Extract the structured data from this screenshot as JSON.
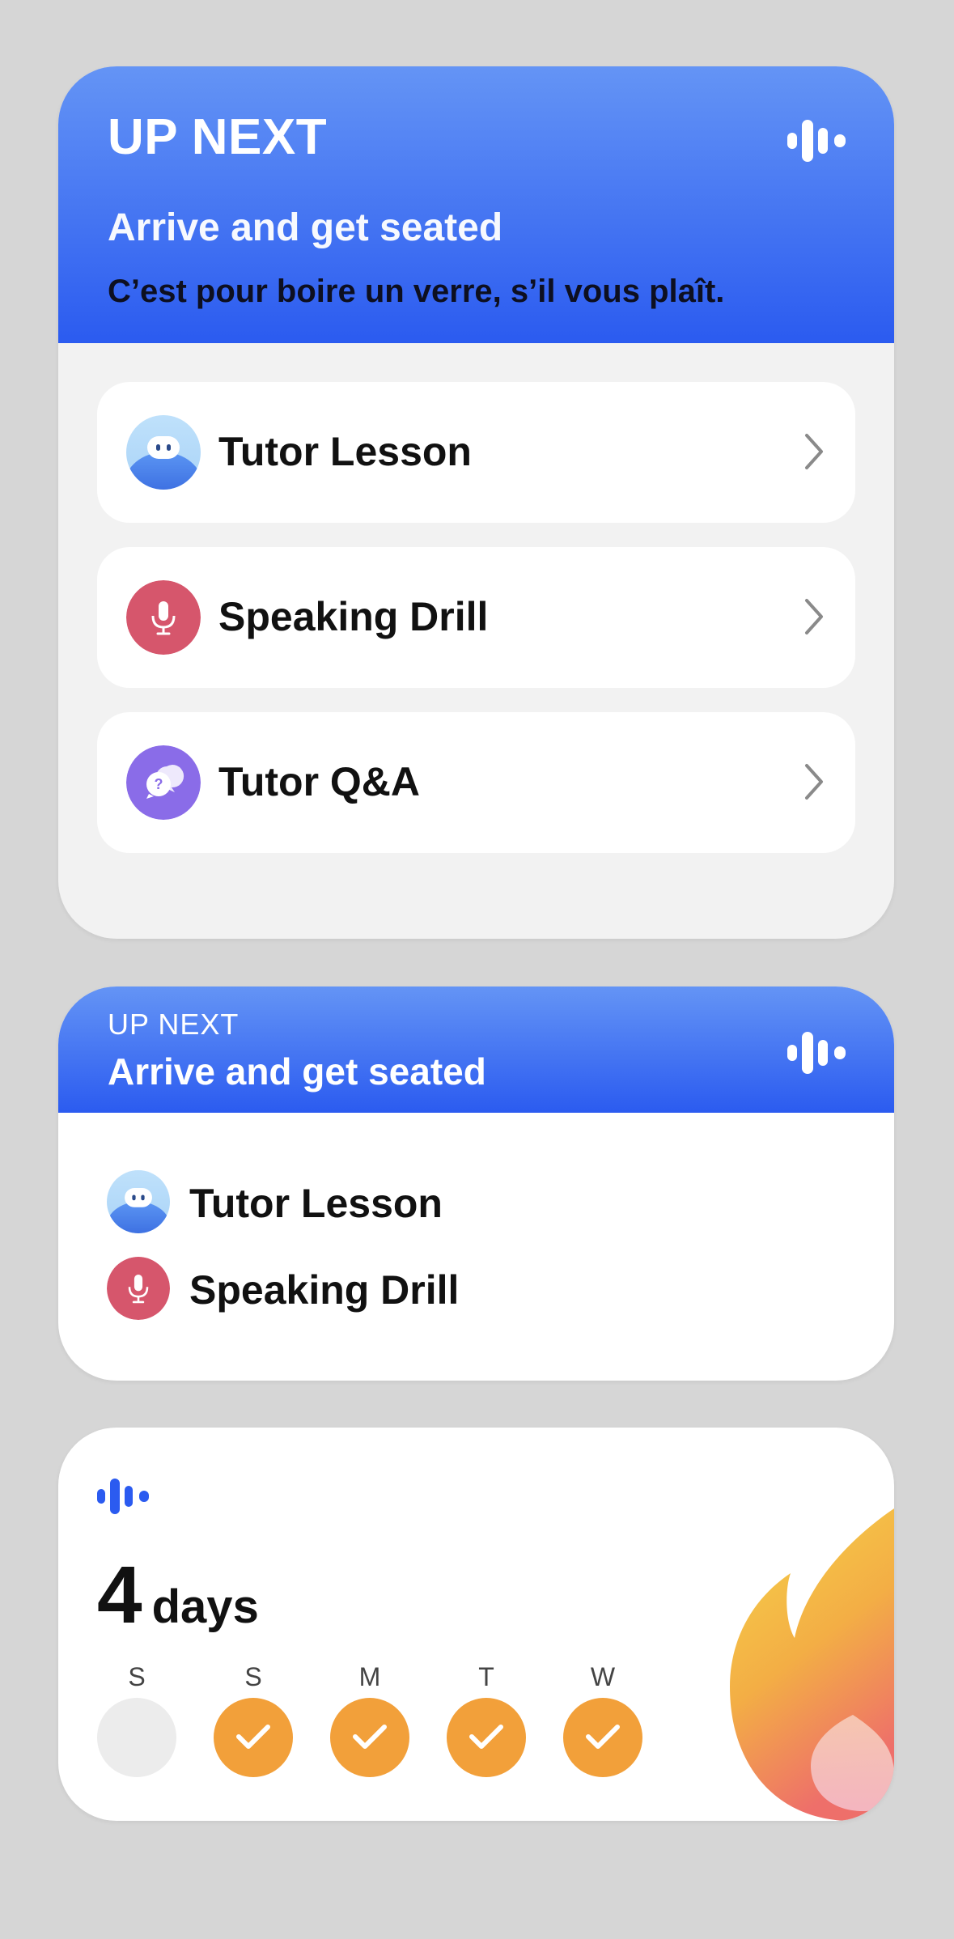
{
  "colors": {
    "header_gradient_top": "#6494f5",
    "header_gradient_bottom": "#2b5bf0",
    "background": "#d6d6d6",
    "card_background": "#ffffff",
    "streak_check": "#f2a03a",
    "tutor_avatar": "#4a84f0",
    "speaking_drill": "#d6566c",
    "tutor_qa": "#8a6ce8"
  },
  "widget_large": {
    "up_next_label": "UP NEXT",
    "scene_title": "Arrive and get seated",
    "scene_phrase": "C’est pour boire un verre, s’il vous plaît.",
    "logo_icon": "waveform-logo-icon",
    "items": [
      {
        "label": "Tutor Lesson",
        "icon": "tutor-avatar-icon"
      },
      {
        "label": "Speaking Drill",
        "icon": "microphone-icon"
      },
      {
        "label": "Tutor Q&A",
        "icon": "chat-question-icon"
      }
    ]
  },
  "widget_medium": {
    "up_next_label": "UP NEXT",
    "scene_title": "Arrive and get seated",
    "logo_icon": "waveform-logo-icon",
    "items": [
      {
        "label": "Tutor Lesson",
        "icon": "tutor-avatar-icon"
      },
      {
        "label": "Speaking Drill",
        "icon": "microphone-icon"
      }
    ]
  },
  "widget_streak": {
    "streak_count": "4",
    "streak_unit": "days",
    "days": [
      {
        "letter": "S",
        "completed": false
      },
      {
        "letter": "S",
        "completed": true
      },
      {
        "letter": "M",
        "completed": true
      },
      {
        "letter": "T",
        "completed": true
      },
      {
        "letter": "W",
        "completed": true
      }
    ],
    "decoration_icon": "flame-icon"
  }
}
